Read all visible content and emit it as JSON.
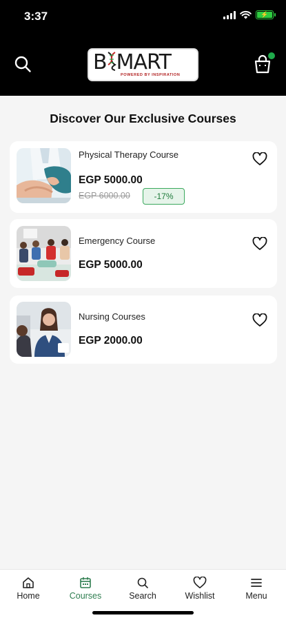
{
  "status_bar": {
    "time": "3:37"
  },
  "header": {
    "logo_text": "BIOMART",
    "logo_tagline": "POWERED BY INSPIRATION",
    "cart_has_items": true,
    "colors": {
      "background": "#000000",
      "badge": "#1faa4b"
    }
  },
  "page": {
    "title": "Discover Our Exclusive Courses"
  },
  "courses": [
    {
      "title": "Physical Therapy Course",
      "price": "EGP 5000.00",
      "old_price": "EGP 6000.00",
      "discount": "-17%",
      "image": "physical-therapy-photo",
      "favorite": false
    },
    {
      "title": "Emergency Course",
      "price": "EGP 5000.00",
      "image": "emergency-training-photo",
      "favorite": false
    },
    {
      "title": "Nursing Courses",
      "price": "EGP 2000.00",
      "image": "nursing-photo",
      "favorite": false
    }
  ],
  "bottom_nav": {
    "active": "Courses",
    "items": [
      {
        "label": "Home",
        "icon": "home-icon"
      },
      {
        "label": "Courses",
        "icon": "calendar-icon"
      },
      {
        "label": "Search",
        "icon": "search-icon"
      },
      {
        "label": "Wishlist",
        "icon": "heart-icon"
      },
      {
        "label": "Menu",
        "icon": "menu-icon"
      }
    ]
  },
  "colors": {
    "accent": "#2e7d4f",
    "discount_border": "#3aa85c",
    "discount_bg": "#e6f4ea"
  }
}
